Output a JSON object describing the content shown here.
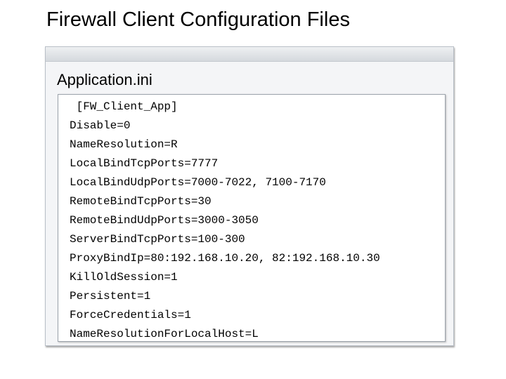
{
  "slide": {
    "title": "Firewall Client Configuration Files"
  },
  "panel": {
    "heading": "Application.ini",
    "lines": [
      " [FW_Client_App]",
      "Disable=0",
      "NameResolution=R",
      "LocalBindTcpPorts=7777",
      "LocalBindUdpPorts=7000-7022, 7100-7170",
      "RemoteBindTcpPorts=30",
      "RemoteBindUdpPorts=3000-3050",
      "ServerBindTcpPorts=100-300",
      "ProxyBindIp=80:192.168.10.20, 82:192.168.10.30",
      "KillOldSession=1",
      "Persistent=1",
      "ForceCredentials=1",
      "NameResolutionForLocalHost=L"
    ]
  }
}
